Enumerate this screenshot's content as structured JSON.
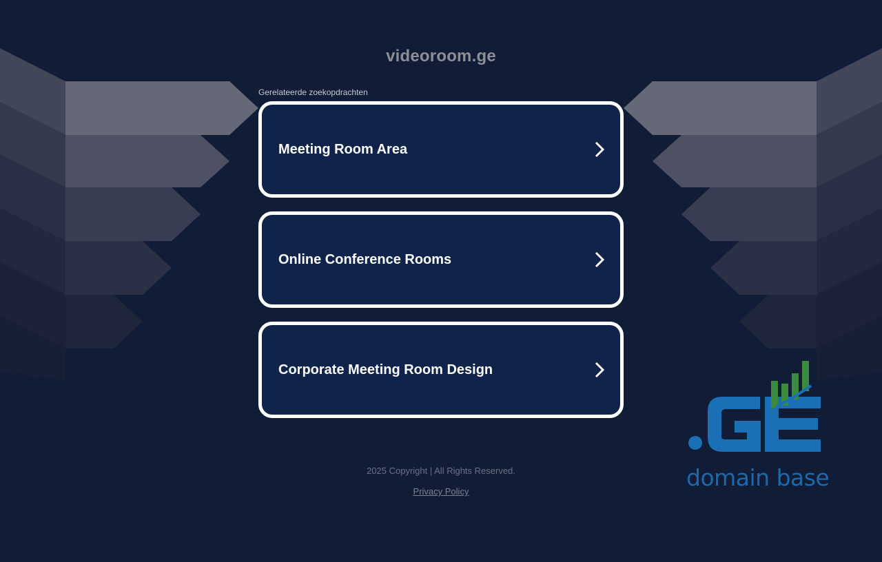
{
  "page": {
    "domain": "videoroom.ge",
    "related_label": "Gerelateerde zoekopdrachten"
  },
  "results": [
    {
      "label": "Meeting Room Area"
    },
    {
      "label": "Online Conference Rooms"
    },
    {
      "label": "Corporate Meeting Room Design"
    }
  ],
  "footer": {
    "copyright": "2025 Copyright | All Rights Reserved.",
    "privacy_label": "Privacy Policy"
  },
  "logo": {
    "mark": ".GE",
    "tagline": "domain base"
  },
  "colors": {
    "background": "#111c37",
    "card_fill": "#10244b",
    "card_border": "#ffffff",
    "logo_blue": "#1a6fb5",
    "logo_green": "#3c8a3c"
  },
  "icons": {
    "result_chevron": "chevron-right-icon"
  }
}
